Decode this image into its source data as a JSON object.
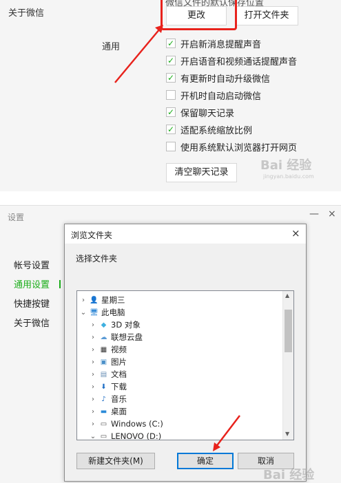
{
  "top_panel": {
    "about_label": "关于微信",
    "cut_heading": "微信文件的默认保存位置",
    "change_button": "更改",
    "open_folder_button": "打开文件夹",
    "general_label": "通用",
    "options": [
      {
        "label": "开启新消息提醒声音",
        "checked": true
      },
      {
        "label": "开启语音和视频通话提醒声音",
        "checked": true
      },
      {
        "label": "有更新时自动升级微信",
        "checked": true
      },
      {
        "label": "开机时自动启动微信",
        "checked": false
      },
      {
        "label": "保留聊天记录",
        "checked": true
      },
      {
        "label": "适配系统缩放比例",
        "checked": true
      },
      {
        "label": "使用系统默认浏览器打开网页",
        "checked": false
      }
    ],
    "clear_button": "清空聊天记录",
    "highlight_color": "#e8221c"
  },
  "settings": {
    "title": "设置",
    "minimize": "—",
    "close": "×",
    "sidebar": [
      {
        "label": "帐号设置",
        "active": false
      },
      {
        "label": "通用设置",
        "active": true
      },
      {
        "label": "快捷按键",
        "active": false
      },
      {
        "label": "关于微信",
        "active": false
      }
    ],
    "accent_color": "#1aad19"
  },
  "dialog": {
    "title": "浏览文件夹",
    "close": "×",
    "prompt": "选择文件夹",
    "tree": [
      {
        "label": "星期三",
        "icon": "user-folder-icon",
        "glyph": "👤",
        "color": "#d9a441",
        "expanded": false,
        "indent": 0
      },
      {
        "label": "此电脑",
        "icon": "computer-icon",
        "glyph": "🖥",
        "color": "#3b8ed8",
        "expanded": true,
        "indent": 0
      },
      {
        "label": "3D 对象",
        "icon": "cube-icon",
        "glyph": "◆",
        "color": "#3fb0e0",
        "expanded": false,
        "indent": 1
      },
      {
        "label": "联想云盘",
        "icon": "cloud-icon",
        "glyph": "☁",
        "color": "#5b9bd5",
        "expanded": false,
        "indent": 1
      },
      {
        "label": "视频",
        "icon": "video-icon",
        "glyph": "▦",
        "color": "#333333",
        "expanded": false,
        "indent": 1
      },
      {
        "label": "图片",
        "icon": "picture-icon",
        "glyph": "▣",
        "color": "#4a90c8",
        "expanded": false,
        "indent": 1
      },
      {
        "label": "文档",
        "icon": "document-icon",
        "glyph": "▤",
        "color": "#6a8fb5",
        "expanded": false,
        "indent": 1
      },
      {
        "label": "下载",
        "icon": "download-icon",
        "glyph": "⬇",
        "color": "#1f6fc5",
        "expanded": false,
        "indent": 1
      },
      {
        "label": "音乐",
        "icon": "music-icon",
        "glyph": "♪",
        "color": "#1f6fc5",
        "expanded": false,
        "indent": 1
      },
      {
        "label": "桌面",
        "icon": "desktop-icon",
        "glyph": "▬",
        "color": "#2b8ad8",
        "expanded": false,
        "indent": 1
      },
      {
        "label": "Windows (C:)",
        "icon": "drive-c-icon",
        "glyph": "▭",
        "color": "#555555",
        "expanded": false,
        "indent": 1
      },
      {
        "label": "LENOVO (D:)",
        "icon": "drive-d-icon",
        "glyph": "▭",
        "color": "#555555",
        "expanded": true,
        "indent": 1
      }
    ],
    "new_folder_button": "新建文件夹(M)",
    "ok_button": "确定",
    "cancel_button": "取消"
  },
  "watermark": {
    "text_top": "Bai 经验",
    "sub_top": "jingyan.baidu.com",
    "text_bottom": "Bai 经验"
  }
}
